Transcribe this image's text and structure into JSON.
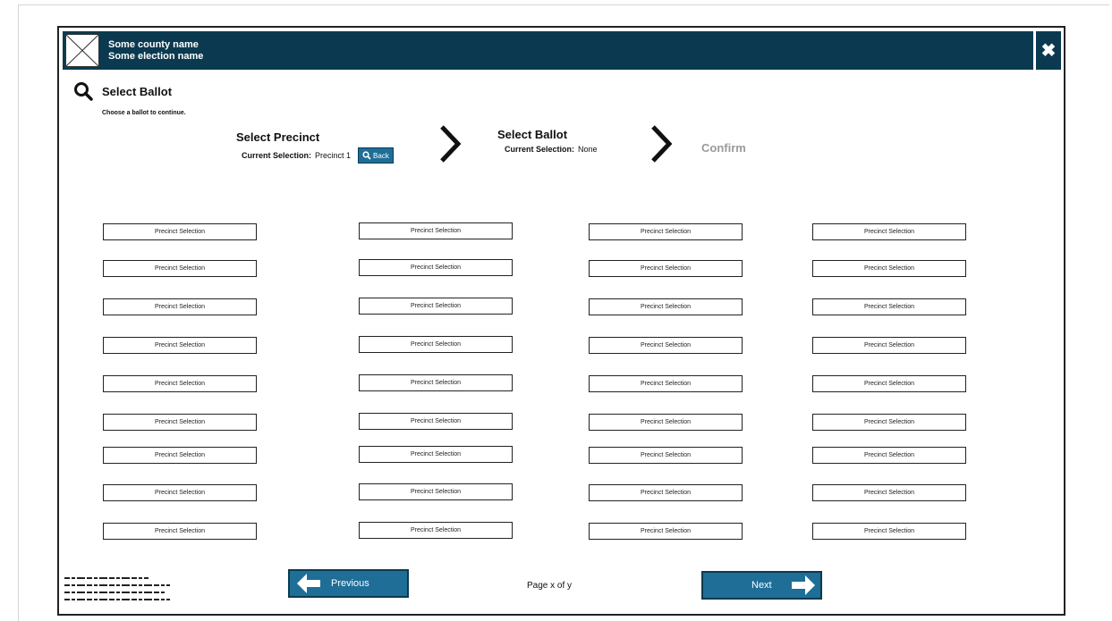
{
  "header": {
    "county": "Some county name",
    "election": "Some election name"
  },
  "title": "Select Ballot",
  "instructions": "Choose a ballot to continue.",
  "steps": {
    "precinct": {
      "title": "Select Precinct",
      "selection_label": "Current Selection:",
      "selection_value": "Precinct 1",
      "back_label": "Back"
    },
    "ballot": {
      "title": "Select Ballot",
      "selection_label": "Current Selection:",
      "selection_value": "None"
    },
    "confirm": {
      "title": "Confirm"
    }
  },
  "grid": {
    "button_label": "Precinct Selection",
    "columns": 4,
    "rows": 9
  },
  "footer": {
    "previous": "Previous",
    "next": "Next",
    "page": "Page x of y"
  }
}
